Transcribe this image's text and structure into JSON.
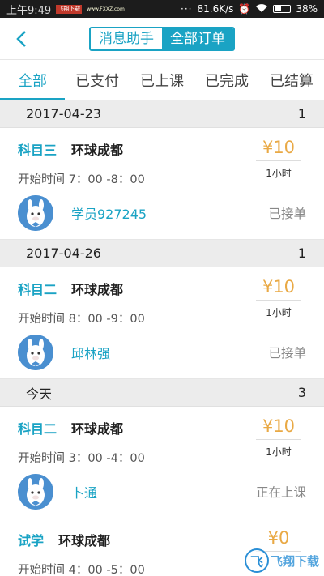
{
  "status_bar": {
    "time": "上午9:49",
    "badge": "飞翔下载",
    "link": "www.FXXZ.com",
    "speed": "81.6K/s",
    "battery": "38%"
  },
  "nav": {
    "segments": [
      {
        "label": "消息助手",
        "active": false
      },
      {
        "label": "全部订单",
        "active": true
      }
    ]
  },
  "tabs": [
    "全部",
    "已支付",
    "已上课",
    "已完成",
    "已结算"
  ],
  "groups": [
    {
      "date": "2017-04-23",
      "count": "1",
      "orders": [
        {
          "subject": "科目三",
          "place": "环球成都",
          "time": "开始时间 7：00 -8：00",
          "price": "¥10",
          "duration": "1小时",
          "student": "学员927245",
          "status": "已接单"
        }
      ]
    },
    {
      "date": "2017-04-26",
      "count": "1",
      "orders": [
        {
          "subject": "科目二",
          "place": "环球成都",
          "time": "开始时间 8：00 -9：00",
          "price": "¥10",
          "duration": "1小时",
          "student": "邱林强",
          "status": "已接单"
        }
      ]
    },
    {
      "date": "今天",
      "count": "3",
      "orders": [
        {
          "subject": "科目二",
          "place": "环球成都",
          "time": "开始时间 3：00 -4：00",
          "price": "¥10",
          "duration": "1小时",
          "student": "卜通",
          "status": "正在上课"
        },
        {
          "subject": "试学",
          "place": "环球成都",
          "time": "开始时间 4：00 -5：00",
          "price": "¥0",
          "duration": "",
          "student": "",
          "status": ""
        }
      ]
    }
  ],
  "watermark": {
    "text": "飞翔下载"
  }
}
